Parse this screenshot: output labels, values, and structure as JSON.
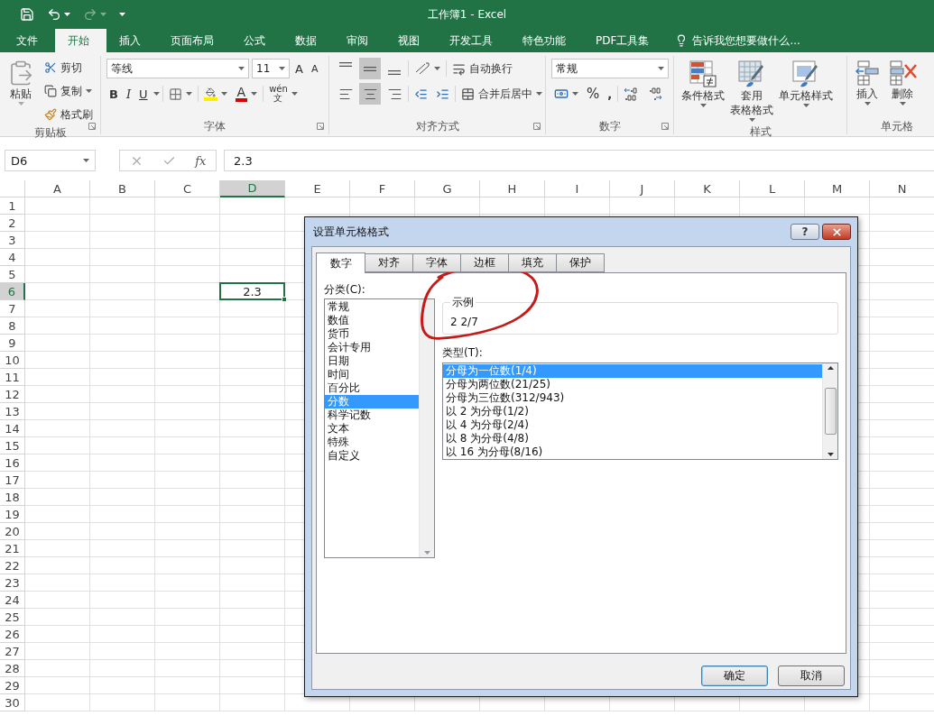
{
  "title_bar": {
    "title": "工作簿1 - Excel"
  },
  "ribbon_tabs": [
    {
      "label": "文件",
      "selected": false
    },
    {
      "label": "开始",
      "selected": true
    },
    {
      "label": "插入",
      "selected": false
    },
    {
      "label": "页面布局",
      "selected": false
    },
    {
      "label": "公式",
      "selected": false
    },
    {
      "label": "数据",
      "selected": false
    },
    {
      "label": "审阅",
      "selected": false
    },
    {
      "label": "视图",
      "selected": false
    },
    {
      "label": "开发工具",
      "selected": false
    },
    {
      "label": "特色功能",
      "selected": false
    },
    {
      "label": "PDF工具集",
      "selected": false
    }
  ],
  "tell_me": "告诉我您想要做什么...",
  "clipboard": {
    "paste": "粘贴",
    "cut": "剪切",
    "copy": "复制",
    "format_painter": "格式刷",
    "group_label": "剪贴板"
  },
  "font": {
    "font_name": "等线",
    "font_size": "11",
    "grow": "A",
    "shrink": "A",
    "bold": "B",
    "italic": "I",
    "underline": "U",
    "font_color_letter": "A",
    "phonetic_top": "wén",
    "phonetic_bottom": "文",
    "group_label": "字体"
  },
  "alignment": {
    "vertical": [
      {
        "kind": "top",
        "selected": false
      },
      {
        "kind": "middle",
        "selected": true
      },
      {
        "kind": "bottom",
        "selected": false
      }
    ],
    "horizontal": [
      {
        "kind": "left",
        "selected": false
      },
      {
        "kind": "center",
        "selected": true
      },
      {
        "kind": "right",
        "selected": false
      }
    ],
    "wrap_text": "自动换行",
    "merge_center": "合并后居中",
    "group_label": "对齐方式"
  },
  "number": {
    "format": "常规",
    "percent": "%",
    "comma": ",",
    "group_label": "数字"
  },
  "styles": {
    "buttons": [
      {
        "kind": "conditional",
        "lines": [
          "条件格式"
        ]
      },
      {
        "kind": "table",
        "lines": [
          "套用",
          "表格格式"
        ]
      },
      {
        "kind": "cell",
        "lines": [
          "单元格样式"
        ]
      }
    ],
    "group_label": "样式"
  },
  "cells": {
    "buttons": [
      {
        "kind": "insert",
        "label": "插入"
      },
      {
        "kind": "delete",
        "label": "删除"
      }
    ],
    "group_label": "单元格"
  },
  "formula_bar": {
    "name_box": "D6",
    "function_label": "fx",
    "value": "2.3"
  },
  "sheet": {
    "columns": [
      {
        "label": "A",
        "selected": false
      },
      {
        "label": "B",
        "selected": false
      },
      {
        "label": "C",
        "selected": false
      },
      {
        "label": "D",
        "selected": true
      },
      {
        "label": "E",
        "selected": false
      },
      {
        "label": "F",
        "selected": false
      },
      {
        "label": "G",
        "selected": false
      },
      {
        "label": "H",
        "selected": false
      },
      {
        "label": "I",
        "selected": false
      },
      {
        "label": "J",
        "selected": false
      },
      {
        "label": "K",
        "selected": false
      },
      {
        "label": "L",
        "selected": false
      },
      {
        "label": "M",
        "selected": false
      },
      {
        "label": "N",
        "selected": false
      }
    ],
    "rows": [
      {
        "label": "1",
        "selected": false
      },
      {
        "label": "2",
        "selected": false
      },
      {
        "label": "3",
        "selected": false
      },
      {
        "label": "4",
        "selected": false
      },
      {
        "label": "5",
        "selected": false
      },
      {
        "label": "6",
        "selected": true
      },
      {
        "label": "7",
        "selected": false
      },
      {
        "label": "8",
        "selected": false
      },
      {
        "label": "9",
        "selected": false
      },
      {
        "label": "10",
        "selected": false
      },
      {
        "label": "11",
        "selected": false
      },
      {
        "label": "12",
        "selected": false
      },
      {
        "label": "13",
        "selected": false
      },
      {
        "label": "14",
        "selected": false
      },
      {
        "label": "15",
        "selected": false
      },
      {
        "label": "16",
        "selected": false
      },
      {
        "label": "17",
        "selected": false
      },
      {
        "label": "18",
        "selected": false
      },
      {
        "label": "19",
        "selected": false
      },
      {
        "label": "20",
        "selected": false
      },
      {
        "label": "21",
        "selected": false
      },
      {
        "label": "22",
        "selected": false
      },
      {
        "label": "23",
        "selected": false
      },
      {
        "label": "24",
        "selected": false
      },
      {
        "label": "25",
        "selected": false
      },
      {
        "label": "26",
        "selected": false
      },
      {
        "label": "27",
        "selected": false
      },
      {
        "label": "28",
        "selected": false
      },
      {
        "label": "29",
        "selected": false
      },
      {
        "label": "30",
        "selected": false
      }
    ],
    "active_cell_value": "2.3"
  },
  "dialog": {
    "title": "设置单元格格式",
    "help": "?",
    "tabs": [
      {
        "label": "数字",
        "selected": true
      },
      {
        "label": "对齐",
        "selected": false
      },
      {
        "label": "字体",
        "selected": false
      },
      {
        "label": "边框",
        "selected": false
      },
      {
        "label": "填充",
        "selected": false
      },
      {
        "label": "保护",
        "selected": false
      }
    ],
    "category_label": "分类(C):",
    "categories": [
      {
        "label": "常规",
        "selected": false
      },
      {
        "label": "数值",
        "selected": false
      },
      {
        "label": "货币",
        "selected": false
      },
      {
        "label": "会计专用",
        "selected": false
      },
      {
        "label": "日期",
        "selected": false
      },
      {
        "label": "时间",
        "selected": false
      },
      {
        "label": "百分比",
        "selected": false
      },
      {
        "label": "分数",
        "selected": true
      },
      {
        "label": "科学记数",
        "selected": false
      },
      {
        "label": "文本",
        "selected": false
      },
      {
        "label": "特殊",
        "selected": false
      },
      {
        "label": "自定义",
        "selected": false
      }
    ],
    "sample_label": "示例",
    "sample_value": "2 2/7",
    "type_label": "类型(T):",
    "types": [
      {
        "label": "分母为一位数(1/4)",
        "selected": true
      },
      {
        "label": "分母为两位数(21/25)",
        "selected": false
      },
      {
        "label": "分母为三位数(312/943)",
        "selected": false
      },
      {
        "label": "以 2 为分母(1/2)",
        "selected": false
      },
      {
        "label": "以 4 为分母(2/4)",
        "selected": false
      },
      {
        "label": "以 8 为分母(4/8)",
        "selected": false
      },
      {
        "label": "以 16 为分母(8/16)",
        "selected": false
      }
    ],
    "buttons": [
      {
        "label": "确定",
        "default": true
      },
      {
        "label": "取消",
        "default": false
      }
    ]
  }
}
